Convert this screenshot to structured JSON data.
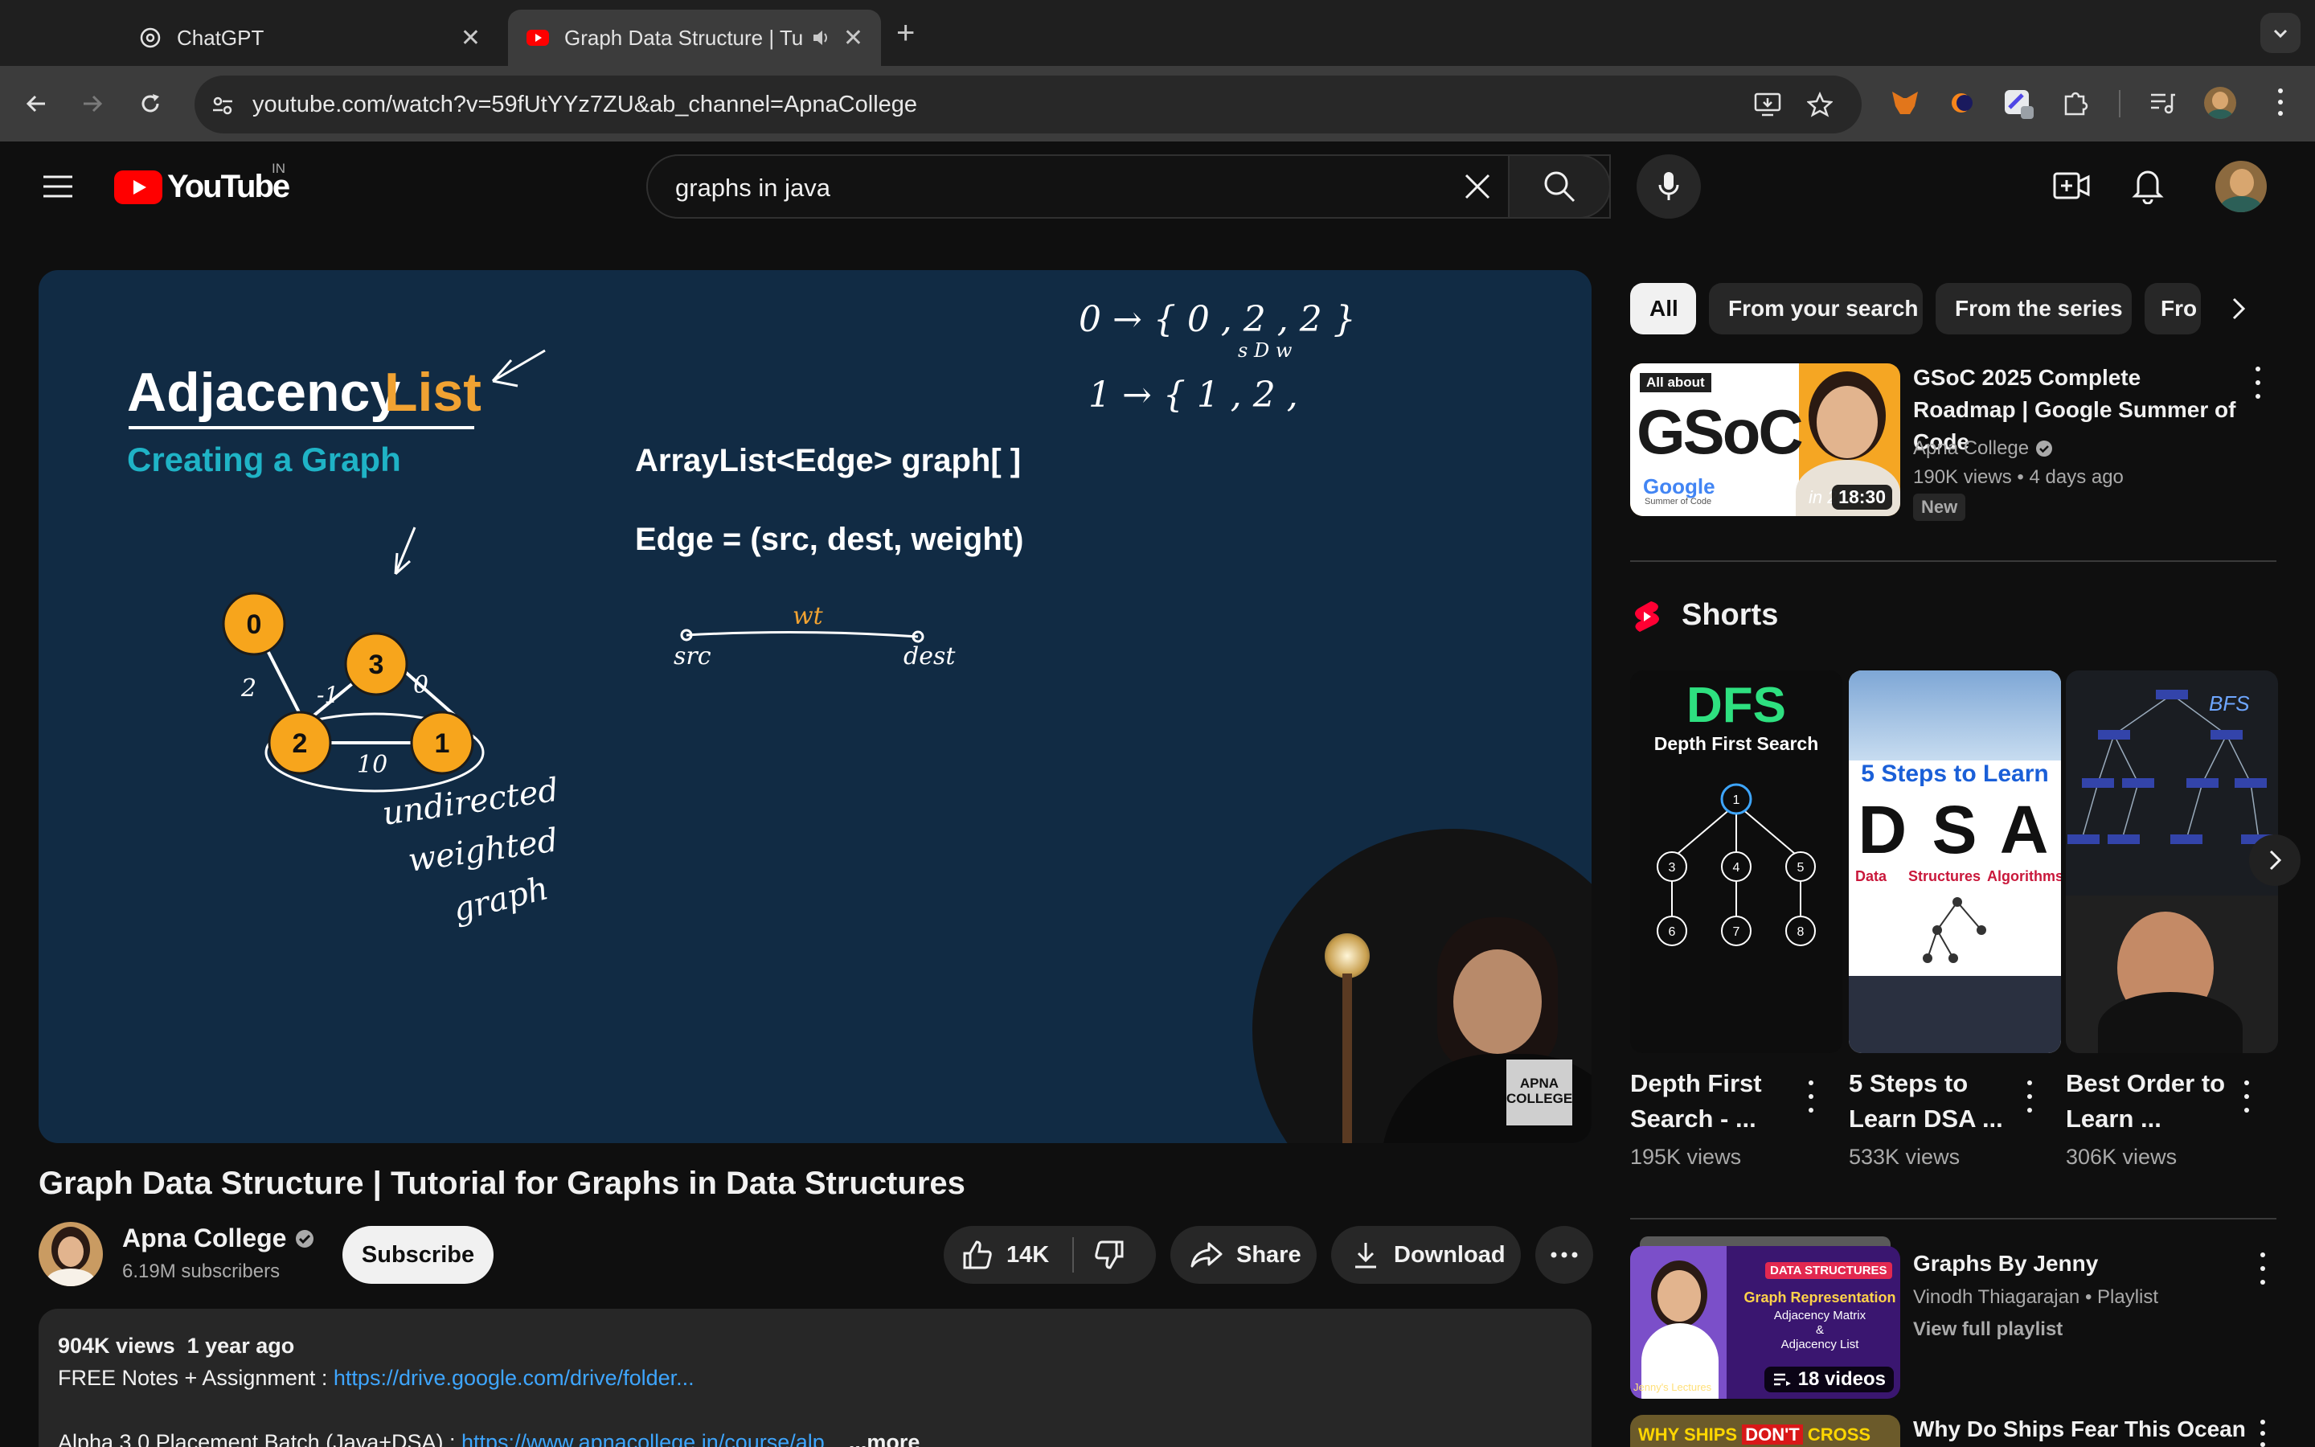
{
  "browser": {
    "tabs": [
      {
        "title": "ChatGPT",
        "active": false
      },
      {
        "title": "Graph Data Structure | Tut",
        "active": true
      }
    ],
    "url": "youtube.com/watch?v=59fUtYYz7ZU&ab_channel=ApnaCollege"
  },
  "masthead": {
    "logo_text": "YouTube",
    "country_code": "IN",
    "search_value": "graphs in java"
  },
  "video": {
    "board": {
      "heading_left": "Adjacency",
      "heading_right": "List",
      "subheading": "Creating a Graph",
      "code_line": "ArrayList<Edge> graph[ ]",
      "edge_def": "Edge = (src, dest, weight)",
      "edge_weight_label": "wt",
      "edge_src_label": "src",
      "edge_dest_label": "dest",
      "note_1": "undirected",
      "note_2": "weighted",
      "note_3": "graph",
      "nodes": [
        "0",
        "3",
        "2",
        "1"
      ],
      "edge_weights": [
        "2",
        "-1",
        "0",
        "10"
      ],
      "list_row_0": "0 → { 0 , 2 , 2 }",
      "list_row_0_sub": "s     D     w",
      "list_row_1": "1 → { 1 , 2 ,"
    },
    "watermark": "APNA COLLEGE",
    "title": "Graph Data Structure | Tutorial for Graphs in Data Structures",
    "channel": {
      "name": "Apna College",
      "subscribers": "6.19M subscribers",
      "subscribe_label": "Subscribe"
    },
    "actions": {
      "likes": "14K",
      "share": "Share",
      "download": "Download"
    },
    "description": {
      "views": "904K views",
      "age": "1 year ago",
      "line1_prefix": "FREE Notes + Assignment : ",
      "line1_link": "https://drive.google.com/drive/folder...",
      "line2_prefix": "Alpha 3.0 Placement Batch (Java+DSA) : ",
      "line2_link": "https://www.apnacollege.in/course/alp...",
      "more": "...more"
    }
  },
  "sidebar": {
    "chips": [
      "All",
      "From your search",
      "From the series",
      "Fro"
    ],
    "recommended": {
      "title": "GSoC 2025 Complete Roadmap | Google Summer of Code",
      "channel": "Apna College",
      "views": "190K views",
      "age": "4 days ago",
      "badge": "New",
      "duration": "18:30",
      "thumb_top": "All about",
      "thumb_big": "GSoC",
      "thumb_year": "in 2025",
      "thumb_google": "Google",
      "thumb_google_sub": "Summer of Code"
    },
    "shorts_header": "Shorts",
    "shorts": [
      {
        "title": "Depth First Search - ...",
        "views": "195K views",
        "thumb_big": "DFS",
        "thumb_sub": "Depth First Search",
        "tree_nodes": [
          "1",
          "3",
          "4",
          "5",
          "6",
          "7",
          "8"
        ]
      },
      {
        "title": "5 Steps to Learn DSA ...",
        "views": "533K views",
        "thumb_top": "5 Steps to Learn",
        "thumb_big": "D S A",
        "thumb_words": [
          "Data",
          "Structures",
          "Algorithms"
        ]
      },
      {
        "title": "Best Order to Learn ...",
        "views": "306K views",
        "thumb_label": "BFS"
      }
    ],
    "playlist": {
      "title": "Graphs By Jenny",
      "owner": "Vinodh Thiagarajan",
      "type": "Playlist",
      "link": "View full playlist",
      "count": "18 videos",
      "thumb_badge": "DATA STRUCTURES",
      "thumb_title": "Graph Representation",
      "thumb_lines": [
        "Adjacency Matrix",
        "&",
        "Adjacency List"
      ],
      "thumb_footer": "Jenny's Lectures"
    },
    "next_video": {
      "title": "Why Do Ships Fear This Ocean",
      "thumb_text_a": "WHY SHIPS",
      "thumb_text_b": "DON'T",
      "thumb_text_c": "CROSS"
    }
  },
  "colors": {
    "background": "#0f0f0f",
    "youtube_red": "#ff0000",
    "board": "#112b44",
    "accent_orange": "#f0a232",
    "accent_teal": "#1fb3c6",
    "link": "#3ea6ff"
  }
}
